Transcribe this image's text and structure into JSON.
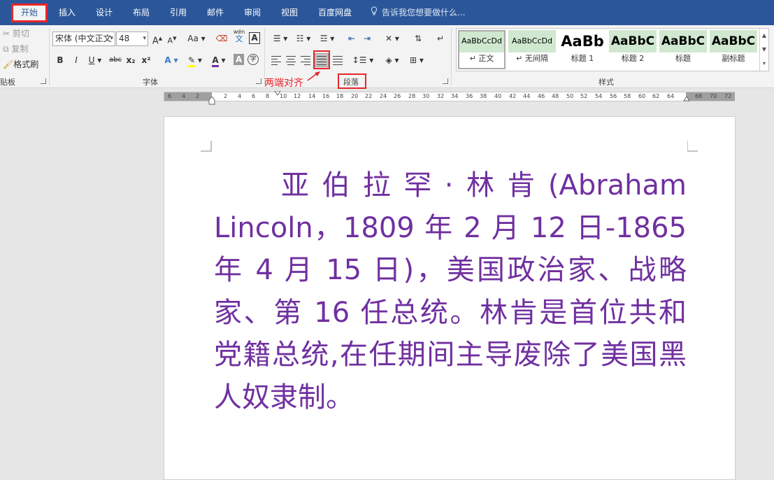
{
  "menu": {
    "tabs": [
      "开始",
      "插入",
      "设计",
      "布局",
      "引用",
      "邮件",
      "审阅",
      "视图",
      "百度网盘"
    ],
    "active_tab": "开始",
    "tell_me": "告诉我您想要做什么..."
  },
  "clipboard": {
    "cut": "剪切",
    "copy": "复制",
    "format_painter": "格式刷",
    "label": "贴板"
  },
  "font": {
    "name": "宋体 (中文正文",
    "size": "48",
    "label": "字体",
    "grow": "A",
    "shrink": "A",
    "case": "Aa",
    "phonetic_top": "wén",
    "phonetic_bottom": "文",
    "bold": "B",
    "italic": "I",
    "underline": "U",
    "strike": "abc",
    "subscript": "x₂",
    "superscript": "x²",
    "font_color_glyph": "A",
    "char_shading": "A",
    "enclose": "字"
  },
  "paragraph": {
    "label": "段落"
  },
  "styles": {
    "label": "样式",
    "items": [
      {
        "preview": "AaBbCcDd",
        "name": "↵ 正文"
      },
      {
        "preview": "AaBbCcDd",
        "name": "↵ 无间隔"
      },
      {
        "preview": "AaBb",
        "name": "标题 1"
      },
      {
        "preview": "AaBbC",
        "name": "标题 2"
      },
      {
        "preview": "AaBbC",
        "name": "标题"
      },
      {
        "preview": "AaBbC",
        "name": "副标题"
      }
    ]
  },
  "annotation": "两端对齐",
  "ruler": {
    "numbers": [
      "6",
      "4",
      "2",
      "2",
      "4",
      "6",
      "8",
      "10",
      "12",
      "14",
      "16",
      "18",
      "20",
      "22",
      "24",
      "26",
      "28",
      "30",
      "32",
      "34",
      "36",
      "38",
      "40",
      "42",
      "44",
      "46",
      "48",
      "50",
      "52",
      "54",
      "56",
      "58",
      "60",
      "62",
      "64",
      "68",
      "70",
      "72"
    ]
  },
  "document": {
    "text": "亚伯拉罕·林肯(Abraham Lincoln，1809 年 2 月 12 日-1865 年 4 月 15 日)，美国政治家、战略家、第 16 任总统。林肯是首位共和党籍总统,在任期间主导废除了美国黑人奴隶制。",
    "color": "#7030a0"
  },
  "colors": {
    "titlebar": "#2b579a",
    "highlight": "#e8262a",
    "style_preview_bg": "#cfe8cf"
  }
}
